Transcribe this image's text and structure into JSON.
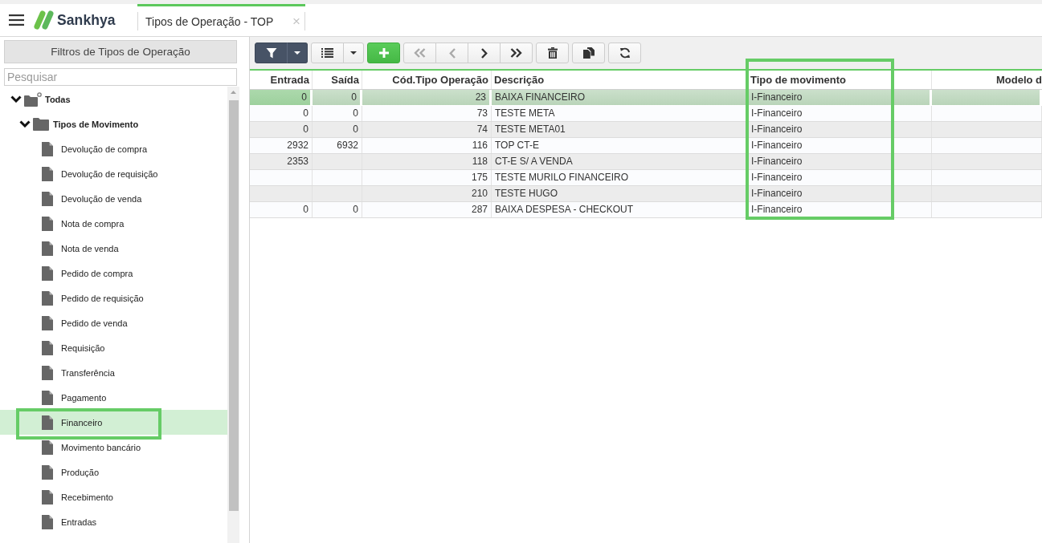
{
  "app_bar": {
    "logo": "Sankhya",
    "tabs": [
      {
        "label": "Tipos de Operação - TOP",
        "close": "×",
        "selected": true
      }
    ]
  },
  "filter_panel": {
    "title": "Filtros de Tipos de Operação",
    "search": {
      "placeholder": "Pesquisar"
    },
    "tree": [
      {
        "label": "Todas",
        "kind": "root",
        "expanded": true,
        "selected": false,
        "outlined": false,
        "children": [
          {
            "label": "Tipos de Movimento",
            "kind": "folder",
            "expanded": true,
            "selected": false,
            "outlined": false,
            "children": [
              {
                "label": "Devolução de compra",
                "kind": "leaf",
                "selected": false,
                "outlined": false
              },
              {
                "label": "Devolução de requisição",
                "kind": "leaf",
                "selected": false,
                "outlined": false
              },
              {
                "label": "Devolução de venda",
                "kind": "leaf",
                "selected": false,
                "outlined": false
              },
              {
                "label": "Nota de compra",
                "kind": "leaf",
                "selected": false,
                "outlined": false
              },
              {
                "label": "Nota de venda",
                "kind": "leaf",
                "selected": false,
                "outlined": false
              },
              {
                "label": "Pedido de compra",
                "kind": "leaf",
                "selected": false,
                "outlined": false
              },
              {
                "label": "Pedido de requisição",
                "kind": "leaf",
                "selected": false,
                "outlined": false
              },
              {
                "label": "Pedido de venda",
                "kind": "leaf",
                "selected": false,
                "outlined": false
              },
              {
                "label": "Requisição",
                "kind": "leaf",
                "selected": false,
                "outlined": false
              },
              {
                "label": "Transferência",
                "kind": "leaf",
                "selected": false,
                "outlined": false
              },
              {
                "label": "Pagamento",
                "kind": "leaf",
                "selected": false,
                "outlined": false
              },
              {
                "label": "Financeiro",
                "kind": "leaf",
                "selected": true,
                "outlined": true
              },
              {
                "label": "Movimento bancário",
                "kind": "leaf",
                "selected": false,
                "outlined": false
              },
              {
                "label": "Produção",
                "kind": "leaf",
                "selected": false,
                "outlined": false
              },
              {
                "label": "Recebimento",
                "kind": "leaf",
                "selected": false,
                "outlined": false
              },
              {
                "label": "Entradas",
                "kind": "leaf",
                "selected": false,
                "outlined": false
              }
            ]
          }
        ]
      }
    ]
  },
  "toolbar": {
    "groups": [
      {
        "buttons": [
          {
            "kind": "filter",
            "dropdown": true,
            "disabled": false
          }
        ]
      },
      {
        "buttons": [
          {
            "kind": "list",
            "dropdown": true,
            "disabled": false
          }
        ]
      },
      {
        "buttons": [
          {
            "kind": "add",
            "dropdown": false,
            "disabled": false
          }
        ]
      },
      {
        "buttons": [
          {
            "kind": "first",
            "dropdown": false,
            "disabled": true
          },
          {
            "kind": "previous",
            "dropdown": false,
            "disabled": true
          },
          {
            "kind": "next",
            "dropdown": false,
            "disabled": false
          },
          {
            "kind": "last",
            "dropdown": false,
            "disabled": false
          }
        ]
      },
      {
        "buttons": [
          {
            "kind": "delete",
            "dropdown": false,
            "disabled": false
          }
        ]
      },
      {
        "buttons": [
          {
            "kind": "copy",
            "dropdown": false,
            "disabled": false
          }
        ]
      },
      {
        "buttons": [
          {
            "kind": "refresh",
            "dropdown": false,
            "disabled": false
          }
        ]
      }
    ]
  },
  "table": {
    "columns": [
      {
        "label": "Entrada",
        "kind": "numeric",
        "outlined": false
      },
      {
        "label": "Saída",
        "kind": "numeric",
        "outlined": false
      },
      {
        "label": "Cód.Tipo Operação",
        "kind": "numeric",
        "outlined": false
      },
      {
        "label": "Descrição",
        "kind": "text",
        "outlined": false
      },
      {
        "label": "Tipo de movimento",
        "kind": "text",
        "outlined": true
      },
      {
        "label": "Modelo d",
        "kind": "numeric",
        "outlined": false
      }
    ],
    "rows": [
      {
        "cells": [
          "0",
          "0",
          "23",
          "BAIXA FINANCEIRO",
          "I-Financeiro"
        ],
        "selected": true
      },
      {
        "cells": [
          "0",
          "0",
          "73",
          "TESTE META",
          "I-Financeiro"
        ],
        "selected": false
      },
      {
        "cells": [
          "0",
          "0",
          "74",
          "TESTE META01",
          "I-Financeiro"
        ],
        "selected": false
      },
      {
        "cells": [
          "2932",
          "6932",
          "116",
          "TOP CT-E",
          "I-Financeiro"
        ],
        "selected": false
      },
      {
        "cells": [
          "2353",
          null,
          "118",
          "CT-E S/ A VENDA",
          "I-Financeiro"
        ],
        "selected": false
      },
      {
        "cells": [
          null,
          null,
          "175",
          "TESTE MURILO FINANCEIRO",
          "I-Financeiro"
        ],
        "selected": false
      },
      {
        "cells": [
          null,
          null,
          "210",
          "TESTE HUGO",
          "I-Financeiro"
        ],
        "selected": false
      },
      {
        "cells": [
          "0",
          "0",
          "287",
          "BAIXA DESPESA - CHECKOUT",
          "I-Financeiro"
        ],
        "selected": false
      }
    ]
  }
}
